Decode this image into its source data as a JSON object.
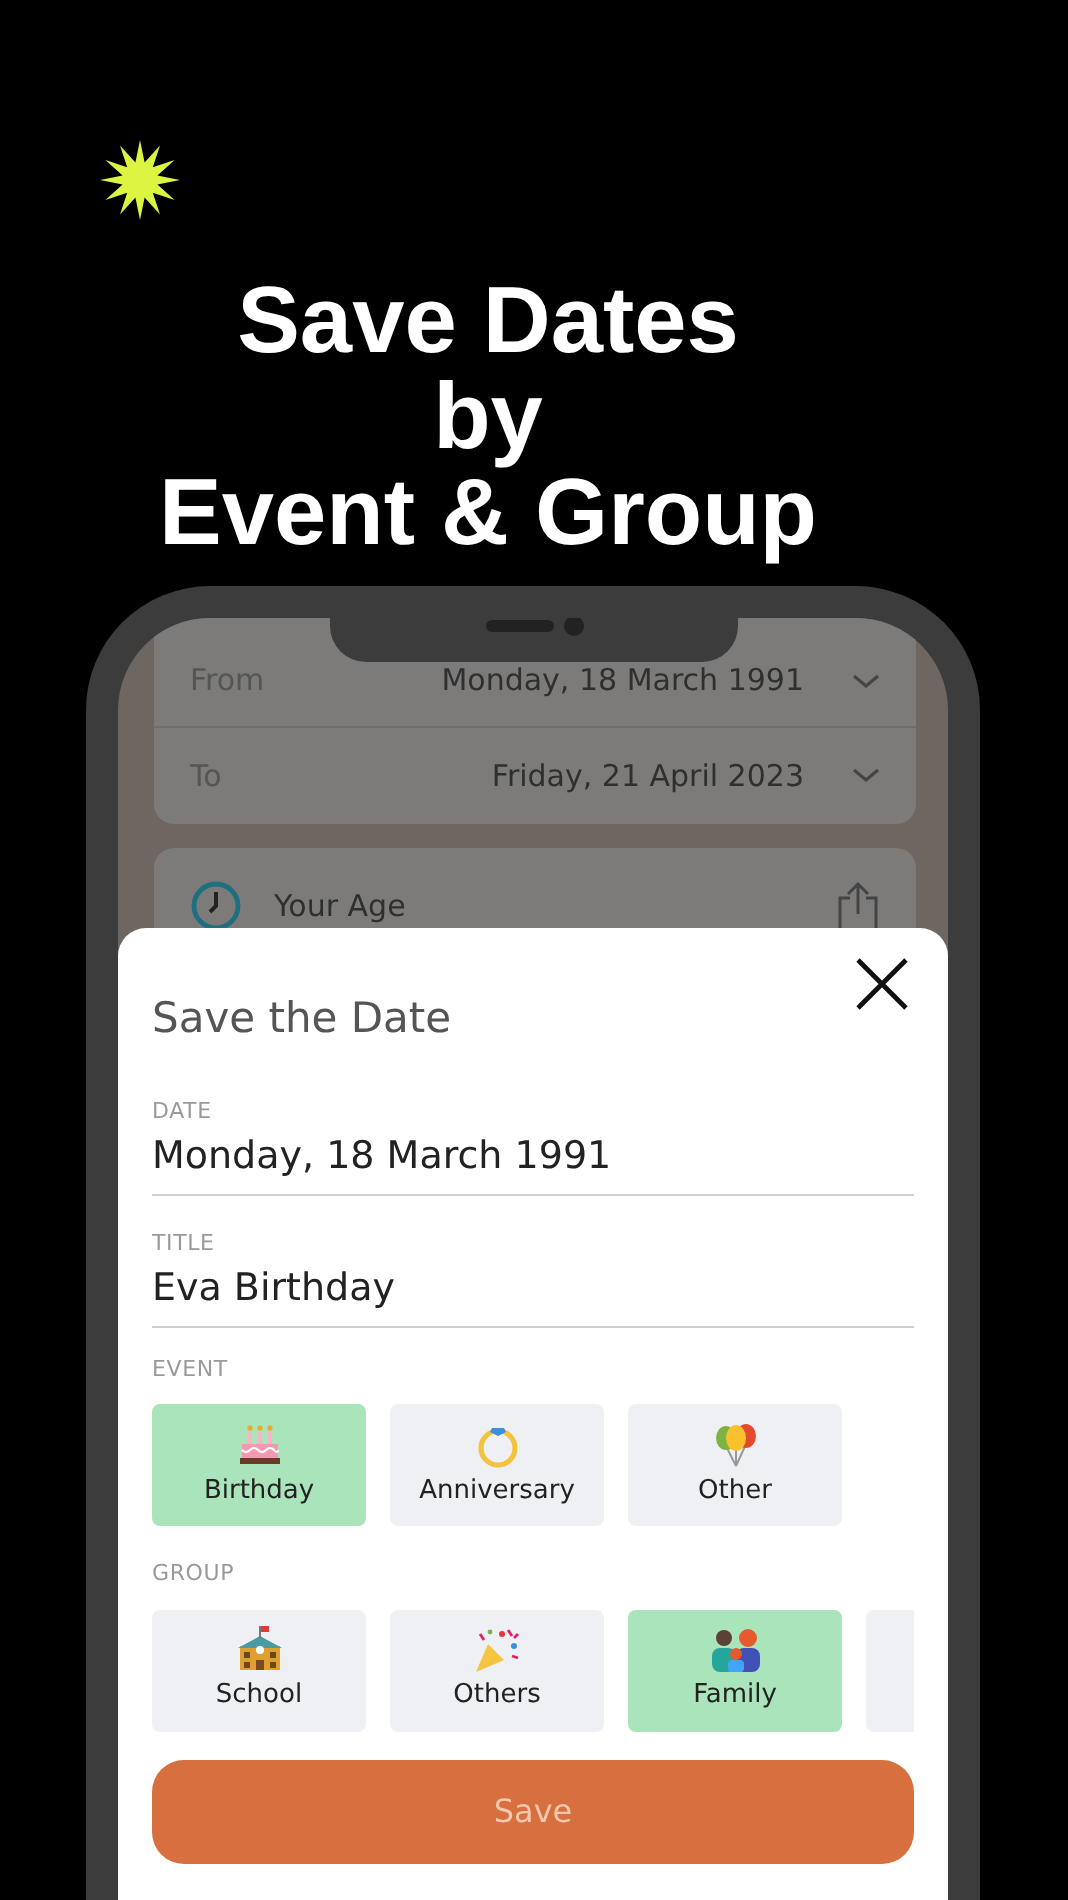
{
  "headline": [
    "Save Dates",
    "by",
    "Event & Group"
  ],
  "background_screen": {
    "range": [
      {
        "label": "From",
        "value": "Monday, 18 March 1991"
      },
      {
        "label": "To",
        "value": "Friday, 21 April 2023"
      }
    ],
    "age_card": {
      "label": "Your Age"
    }
  },
  "sheet": {
    "title": "Save the Date",
    "fields": [
      {
        "label": "DATE",
        "value": "Monday, 18 March 1991"
      },
      {
        "label": "TITLE",
        "value": "Eva Birthday"
      }
    ],
    "event_label": "EVENT",
    "events": [
      {
        "kind": "cake",
        "label": "Birthday",
        "selected": true
      },
      {
        "kind": "ring",
        "label": "Anniversary",
        "selected": false
      },
      {
        "kind": "balloons",
        "label": "Other",
        "selected": false
      }
    ],
    "group_label": "GROUP",
    "groups": [
      {
        "kind": "school",
        "label": "School",
        "selected": false
      },
      {
        "kind": "party",
        "label": "Others",
        "selected": false
      },
      {
        "kind": "family",
        "label": "Family",
        "selected": true
      },
      {
        "kind": "partial",
        "selected": false
      }
    ],
    "save_button": "Save"
  }
}
